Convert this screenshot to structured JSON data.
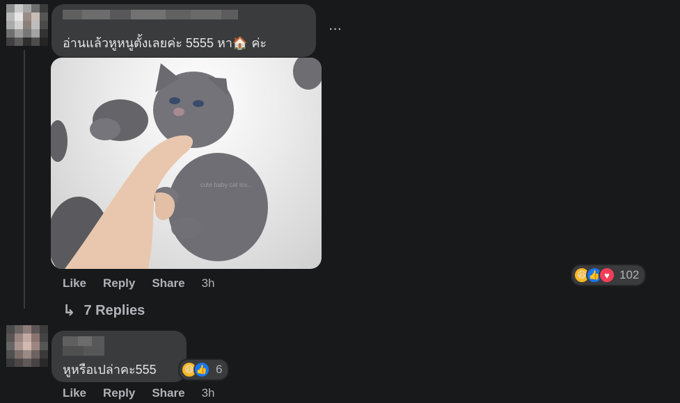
{
  "comments": [
    {
      "text": "อ่านแล้วหูหนูตั้งเลยค่ะ 5555 หา🏠 ค่ะ",
      "actions": {
        "like": "Like",
        "reply": "Reply",
        "share": "Share",
        "time": "3h"
      },
      "reactions": {
        "icons": [
          "haha-icon",
          "like-icon",
          "love-icon"
        ],
        "count": "102"
      },
      "more_icon": "···",
      "image_watermark": "cute baby cat lov..."
    },
    {
      "text": "หูหรือเปล่าคะ555",
      "actions": {
        "like": "Like",
        "reply": "Reply",
        "share": "Share",
        "time": "3h"
      },
      "reactions": {
        "icons": [
          "haha-icon",
          "like-icon"
        ],
        "count": "6"
      }
    }
  ],
  "replies_link": {
    "arrow": "↳",
    "label": "7 Replies"
  },
  "colors": {
    "bg": "#18191a",
    "bubble": "#3a3b3c",
    "text": "#e4e6eb",
    "muted": "#b0b3b8",
    "like": "#1877f2",
    "haha": "#f7b928",
    "love": "#f33e58"
  }
}
